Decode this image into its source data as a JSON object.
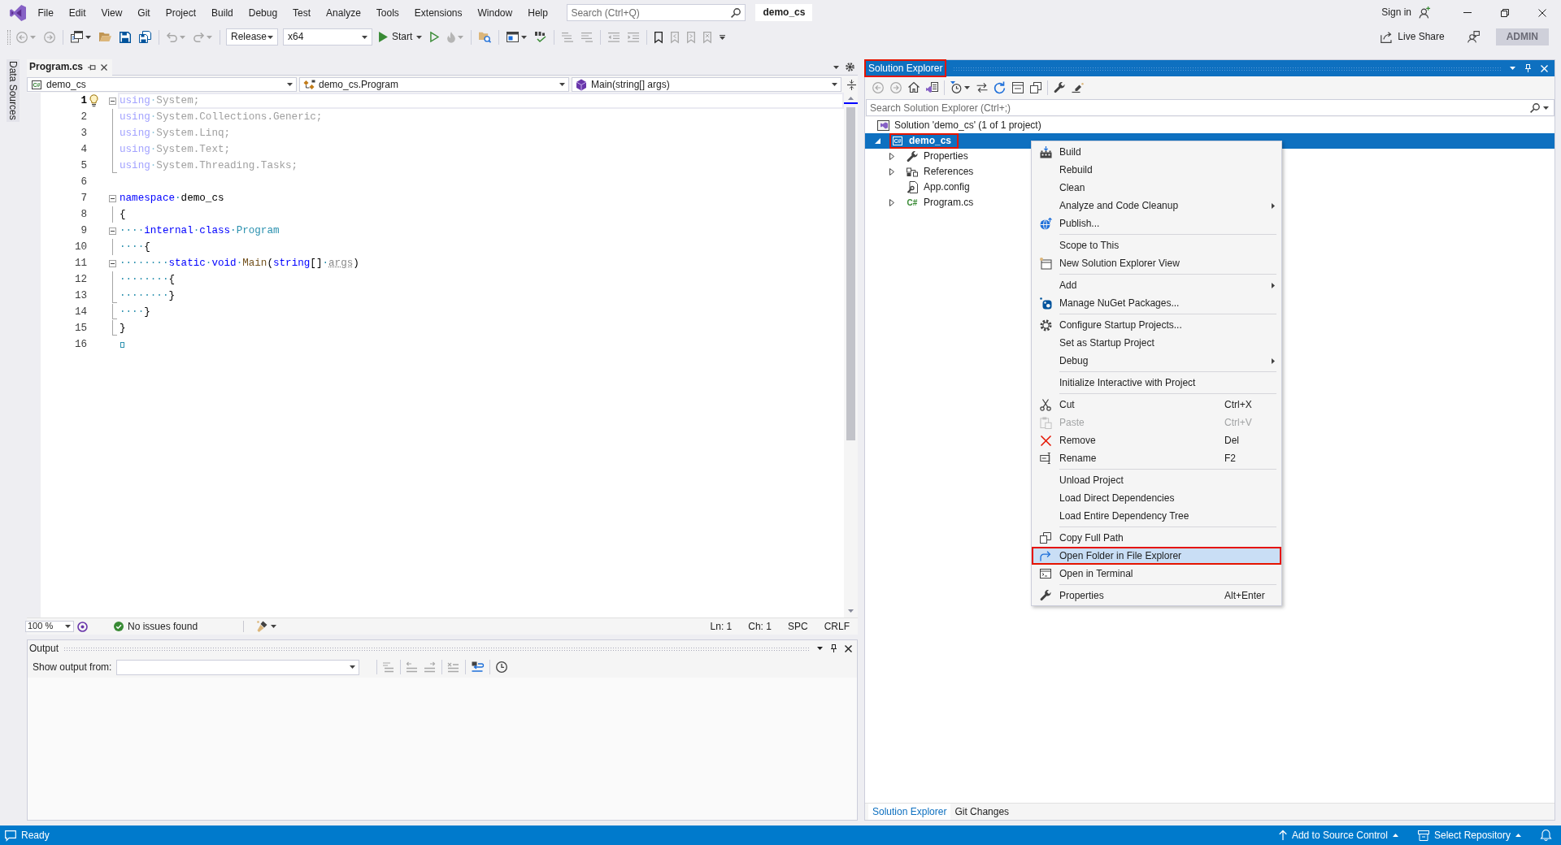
{
  "title_bar": {
    "menu": [
      "File",
      "Edit",
      "View",
      "Git",
      "Project",
      "Build",
      "Debug",
      "Test",
      "Analyze",
      "Tools",
      "Extensions",
      "Window",
      "Help"
    ],
    "search": {
      "placeholder": "Search (Ctrl+Q)"
    },
    "solution_name": "demo_cs",
    "sign_in": "Sign in"
  },
  "toolbar": {
    "items": [
      {
        "kind": "menu_button",
        "disabled": true
      },
      {
        "kind": "button",
        "disabled": true
      },
      {
        "kind": "separator"
      },
      {
        "kind": "menu_button",
        "disabled": false
      },
      {
        "kind": "button",
        "disabled": false
      },
      {
        "kind": "button",
        "disabled": false
      },
      {
        "kind": "button",
        "disabled": false
      },
      {
        "kind": "separator"
      },
      {
        "kind": "menu_button",
        "disabled": true
      },
      {
        "kind": "menu_button",
        "disabled": true
      },
      {
        "kind": "separator"
      },
      {
        "kind": "dropdown",
        "value": "Release"
      },
      {
        "kind": "dropdown",
        "value": "x64"
      },
      {
        "kind": "run",
        "label": "Start"
      },
      {
        "kind": "button",
        "disabled": false
      },
      {
        "kind": "menu_button",
        "disabled": true
      },
      {
        "kind": "separator"
      },
      {
        "kind": "button",
        "disabled": false
      },
      {
        "kind": "separator"
      },
      {
        "kind": "menu_button",
        "disabled": false
      },
      {
        "kind": "button",
        "disabled": false
      },
      {
        "kind": "separator"
      },
      {
        "kind": "button",
        "disabled": true
      },
      {
        "kind": "button",
        "disabled": true
      },
      {
        "kind": "separator"
      },
      {
        "kind": "button",
        "disabled": true
      },
      {
        "kind": "button",
        "disabled": true
      },
      {
        "kind": "separator"
      },
      {
        "kind": "button",
        "disabled": false
      },
      {
        "kind": "button",
        "disabled": true
      },
      {
        "kind": "button",
        "disabled": true
      },
      {
        "kind": "button",
        "disabled": true
      },
      {
        "kind": "overflow"
      }
    ],
    "live_share": "Live Share",
    "account": "ADMIN"
  },
  "left_strip": {
    "tab": "Data Sources"
  },
  "editor": {
    "tabs": [
      {
        "label": "Program.cs",
        "selected": true
      }
    ],
    "navigation": [
      {
        "text": "demo_cs",
        "icon_text": "C#"
      },
      {
        "text": "demo_cs.Program"
      },
      {
        "text": "Main(string[] args)"
      }
    ],
    "lines": [
      {
        "number": "1",
        "kind": "fold",
        "current": true,
        "faded": true,
        "lightbulb": true,
        "eof": false,
        "tokens": [
          {
            "text": "using",
            "kind": "keyword"
          },
          {
            "text": "·",
            "kind": "space"
          },
          {
            "text": "System;",
            "kind": "text"
          }
        ]
      },
      {
        "number": "2",
        "kind": "guide",
        "current": false,
        "faded": true,
        "lightbulb": false,
        "eof": false,
        "tokens": [
          {
            "text": "using",
            "kind": "keyword"
          },
          {
            "text": "·",
            "kind": "space"
          },
          {
            "text": "System.Collections.Generic;",
            "kind": "text"
          }
        ]
      },
      {
        "number": "3",
        "kind": "guide",
        "current": false,
        "faded": true,
        "lightbulb": false,
        "eof": false,
        "tokens": [
          {
            "text": "using",
            "kind": "keyword"
          },
          {
            "text": "·",
            "kind": "space"
          },
          {
            "text": "System.Linq;",
            "kind": "text"
          }
        ]
      },
      {
        "number": "4",
        "kind": "guide",
        "current": false,
        "faded": true,
        "lightbulb": false,
        "eof": false,
        "tokens": [
          {
            "text": "using",
            "kind": "keyword"
          },
          {
            "text": "·",
            "kind": "space"
          },
          {
            "text": "System.Text;",
            "kind": "text"
          }
        ]
      },
      {
        "number": "5",
        "kind": "guide_end",
        "current": false,
        "faded": true,
        "lightbulb": false,
        "eof": false,
        "tokens": [
          {
            "text": "using",
            "kind": "keyword"
          },
          {
            "text": "·",
            "kind": "space"
          },
          {
            "text": "System.Threading.Tasks;",
            "kind": "text"
          }
        ]
      },
      {
        "number": "6",
        "kind": "blank",
        "current": false,
        "lightbulb": false,
        "eof": false
      },
      {
        "number": "7",
        "kind": "fold",
        "current": false,
        "faded": false,
        "lightbulb": false,
        "eof": false,
        "tokens": [
          {
            "text": "namespace",
            "kind": "keyword"
          },
          {
            "text": "·",
            "kind": "space"
          },
          {
            "text": "demo_cs",
            "kind": "text"
          }
        ]
      },
      {
        "number": "8",
        "kind": "guide",
        "current": false,
        "faded": false,
        "lightbulb": false,
        "eof": false,
        "tokens": [
          {
            "text": "{",
            "kind": "text"
          }
        ]
      },
      {
        "number": "9",
        "kind": "fold",
        "current": false,
        "faded": false,
        "lightbulb": false,
        "eof": false,
        "tokens": [
          {
            "text": "····",
            "kind": "space"
          },
          {
            "text": "internal",
            "kind": "keyword"
          },
          {
            "text": "·",
            "kind": "space"
          },
          {
            "text": "class",
            "kind": "keyword"
          },
          {
            "text": "·",
            "kind": "space"
          },
          {
            "text": "Program",
            "kind": "type"
          }
        ]
      },
      {
        "number": "10",
        "kind": "guide",
        "current": false,
        "faded": false,
        "lightbulb": false,
        "eof": false,
        "tokens": [
          {
            "text": "····",
            "kind": "space"
          },
          {
            "text": "{",
            "kind": "text"
          }
        ]
      },
      {
        "number": "11",
        "kind": "fold",
        "current": false,
        "faded": false,
        "lightbulb": false,
        "eof": false,
        "tokens": [
          {
            "text": "········",
            "kind": "space"
          },
          {
            "text": "static",
            "kind": "keyword"
          },
          {
            "text": "·",
            "kind": "space"
          },
          {
            "text": "void",
            "kind": "keyword"
          },
          {
            "text": "·",
            "kind": "space"
          },
          {
            "text": "Main",
            "kind": "method"
          },
          {
            "text": "(",
            "kind": "text"
          },
          {
            "text": "string",
            "kind": "keyword"
          },
          {
            "text": "[]",
            "kind": "text"
          },
          {
            "text": "·",
            "kind": "space"
          },
          {
            "text": "args",
            "kind": "unused"
          },
          {
            "text": ")",
            "kind": "text"
          }
        ]
      },
      {
        "number": "12",
        "kind": "guide",
        "current": false,
        "faded": false,
        "lightbulb": false,
        "eof": false,
        "tokens": [
          {
            "text": "········",
            "kind": "space"
          },
          {
            "text": "{",
            "kind": "text"
          }
        ]
      },
      {
        "number": "13",
        "kind": "guide_end",
        "current": false,
        "faded": false,
        "lightbulb": false,
        "eof": false,
        "tokens": [
          {
            "text": "········",
            "kind": "space"
          },
          {
            "text": "}",
            "kind": "text"
          }
        ]
      },
      {
        "number": "14",
        "kind": "guide_end",
        "current": false,
        "faded": false,
        "lightbulb": false,
        "eof": false,
        "tokens": [
          {
            "text": "····",
            "kind": "space"
          },
          {
            "text": "}",
            "kind": "text"
          }
        ]
      },
      {
        "number": "15",
        "kind": "guide_end",
        "current": false,
        "faded": false,
        "lightbulb": false,
        "eof": false,
        "tokens": [
          {
            "text": "}",
            "kind": "text"
          }
        ]
      },
      {
        "number": "16",
        "kind": "blank",
        "current": false,
        "lightbulb": false,
        "eof": true
      }
    ],
    "status": {
      "zoom": "100 %",
      "issues": {
        "text": "No issues found",
        "has_issues": false
      },
      "indicators": [
        "Ln: 1",
        "Ch: 1",
        "SPC",
        "CRLF"
      ]
    }
  },
  "output": {
    "title": "Output",
    "source_label": "Show output from:",
    "toolbar": [
      {
        "kind": "button",
        "disabled": true
      },
      {
        "kind": "separator"
      },
      {
        "kind": "button",
        "disabled": true
      },
      {
        "kind": "button",
        "disabled": true
      },
      {
        "kind": "separator"
      },
      {
        "kind": "button",
        "disabled": true
      },
      {
        "kind": "separator"
      },
      {
        "kind": "button",
        "disabled": false
      },
      {
        "kind": "separator"
      },
      {
        "kind": "button",
        "disabled": false
      }
    ]
  },
  "solution_explorer": {
    "title": "Solution Explorer",
    "annotated": true,
    "toolbar": [
      {
        "kind": "button",
        "disabled": true
      },
      {
        "kind": "button",
        "disabled": true
      },
      {
        "kind": "button",
        "disabled": false
      },
      {
        "kind": "button",
        "disabled": false
      },
      {
        "kind": "separator"
      },
      {
        "kind": "menu_button",
        "disabled": false
      },
      {
        "kind": "button",
        "disabled": false
      },
      {
        "kind": "button",
        "disabled": false
      },
      {
        "kind": "button",
        "disabled": false
      },
      {
        "kind": "button",
        "disabled": false
      },
      {
        "kind": "separator"
      },
      {
        "kind": "button",
        "disabled": false
      },
      {
        "kind": "button",
        "disabled": false
      }
    ],
    "search": {
      "placeholder": "Search Solution Explorer (Ctrl+;)"
    },
    "tree": [
      {
        "label": "Solution 'demo_cs' (1 of 1 project)",
        "kind": "solution",
        "expandable": false,
        "expanded": true,
        "selected": false,
        "annotated": false,
        "children": [
          {
            "label": "demo_cs",
            "kind": "project",
            "icon_text": "C#",
            "expandable": true,
            "expanded": true,
            "selected": true,
            "annotated": true,
            "children": [
              {
                "label": "Properties",
                "kind": "properties",
                "expandable": true,
                "expanded": false,
                "selected": false,
                "annotated": false
              },
              {
                "label": "References",
                "kind": "references",
                "expandable": true,
                "expanded": false,
                "selected": false,
                "annotated": false
              },
              {
                "label": "App.config",
                "kind": "config",
                "expandable": false,
                "expanded": false,
                "selected": false,
                "annotated": false
              },
              {
                "label": "Program.cs",
                "kind": "source",
                "icon_text": "C#",
                "expandable": true,
                "expanded": false,
                "selected": false,
                "annotated": false
              }
            ]
          }
        ]
      }
    ],
    "tabs": [
      {
        "label": "Solution Explorer",
        "selected": true
      },
      {
        "label": "Git Changes",
        "selected": false
      }
    ]
  },
  "context_menu": {
    "groups": [
      [
        {
          "label": "Build",
          "submenu": false,
          "disabled": false,
          "selected": false,
          "annotated": false
        },
        {
          "label": "Rebuild",
          "submenu": false,
          "disabled": false,
          "selected": false,
          "annotated": false
        },
        {
          "label": "Clean",
          "submenu": false,
          "disabled": false,
          "selected": false,
          "annotated": false
        },
        {
          "label": "Analyze and Code Cleanup",
          "submenu": true,
          "disabled": false,
          "selected": false,
          "annotated": false
        },
        {
          "label": "Publish...",
          "submenu": false,
          "disabled": false,
          "selected": false,
          "annotated": false
        }
      ],
      [
        {
          "label": "Scope to This",
          "submenu": false,
          "disabled": false,
          "selected": false,
          "annotated": false
        },
        {
          "label": "New Solution Explorer View",
          "submenu": false,
          "disabled": false,
          "selected": false,
          "annotated": false
        }
      ],
      [
        {
          "label": "Add",
          "submenu": true,
          "disabled": false,
          "selected": false,
          "annotated": false
        },
        {
          "label": "Manage NuGet Packages...",
          "submenu": false,
          "disabled": false,
          "selected": false,
          "annotated": false
        }
      ],
      [
        {
          "label": "Configure Startup Projects...",
          "submenu": false,
          "disabled": false,
          "selected": false,
          "annotated": false
        },
        {
          "label": "Set as Startup Project",
          "submenu": false,
          "disabled": false,
          "selected": false,
          "annotated": false
        },
        {
          "label": "Debug",
          "submenu": true,
          "disabled": false,
          "selected": false,
          "annotated": false
        }
      ],
      [
        {
          "label": "Initialize Interactive with Project",
          "submenu": false,
          "disabled": false,
          "selected": false,
          "annotated": false
        }
      ],
      [
        {
          "label": "Cut",
          "shortcut": "Ctrl+X",
          "submenu": false,
          "disabled": false,
          "selected": false,
          "annotated": false
        },
        {
          "label": "Paste",
          "shortcut": "Ctrl+V",
          "submenu": false,
          "disabled": true,
          "selected": false,
          "annotated": false
        },
        {
          "label": "Remove",
          "shortcut": "Del",
          "submenu": false,
          "disabled": false,
          "selected": false,
          "annotated": false
        },
        {
          "label": "Rename",
          "shortcut": "F2",
          "submenu": false,
          "disabled": false,
          "selected": false,
          "annotated": false
        }
      ],
      [
        {
          "label": "Unload Project",
          "submenu": false,
          "disabled": false,
          "selected": false,
          "annotated": false
        },
        {
          "label": "Load Direct Dependencies",
          "submenu": false,
          "disabled": false,
          "selected": false,
          "annotated": false
        },
        {
          "label": "Load Entire Dependency Tree",
          "submenu": false,
          "disabled": false,
          "selected": false,
          "annotated": false
        }
      ],
      [
        {
          "label": "Copy Full Path",
          "submenu": false,
          "disabled": false,
          "selected": false,
          "annotated": false
        },
        {
          "label": "Open Folder in File Explorer",
          "submenu": false,
          "disabled": false,
          "selected": true,
          "annotated": true
        },
        {
          "label": "Open in Terminal",
          "submenu": false,
          "disabled": false,
          "selected": false,
          "annotated": false
        }
      ],
      [
        {
          "label": "Properties",
          "shortcut": "Alt+Enter",
          "submenu": false,
          "disabled": false,
          "selected": false,
          "annotated": false
        }
      ]
    ]
  },
  "status_bar": {
    "text": "Ready",
    "source_control": "Add to Source Control",
    "repository": "Select Repository"
  }
}
